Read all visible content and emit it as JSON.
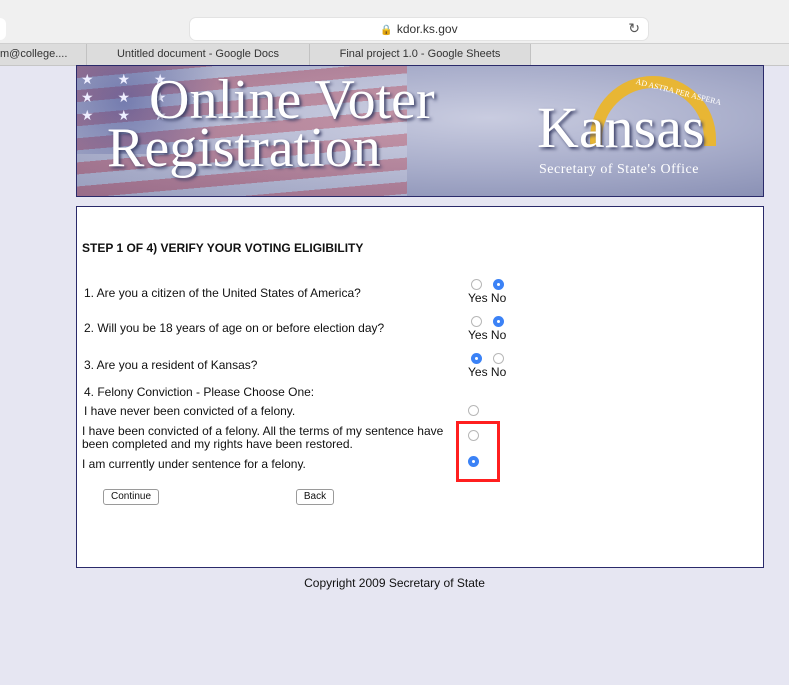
{
  "browser": {
    "url": "kdor.ks.gov",
    "tabs": [
      "m@college....",
      "Untitled document - Google Docs",
      "Final project 1.0 - Google Sheets"
    ]
  },
  "banner": {
    "title_line1": "Online Voter",
    "title_line2": "Registration",
    "state": "Kansas",
    "office": "Secretary of State's Office",
    "motto": "AD ASTRA PER ASPERA"
  },
  "form": {
    "step_title": "STEP 1 OF 4) VERIFY YOUR VOTING ELIGIBILITY",
    "yes_no": "Yes No",
    "questions": [
      {
        "text": "1. Are you a citizen of the United States of America?",
        "selected": "No"
      },
      {
        "text": "2. Will you be 18 years of age on or before election day?",
        "selected": "No"
      },
      {
        "text": "3. Are you a resident of Kansas?",
        "selected": "Yes"
      }
    ],
    "felony": {
      "heading": "4. Felony Conviction - Please Choose One:",
      "options": [
        "I have never been convicted of a felony.",
        "I have been convicted of a felony. All the terms of my sentence have",
        "been completed and my rights have been restored.",
        "I am currently under sentence for a felony."
      ],
      "selected_index": 2
    },
    "continue_label": "Continue",
    "back_label": "Back"
  },
  "footer": {
    "copyright": "Copyright 2009 Secretary of State"
  },
  "colors": {
    "radio_selected": "#3b82f6",
    "highlight_box": "#ff1f1f",
    "page_bg": "#e6e6f2"
  }
}
